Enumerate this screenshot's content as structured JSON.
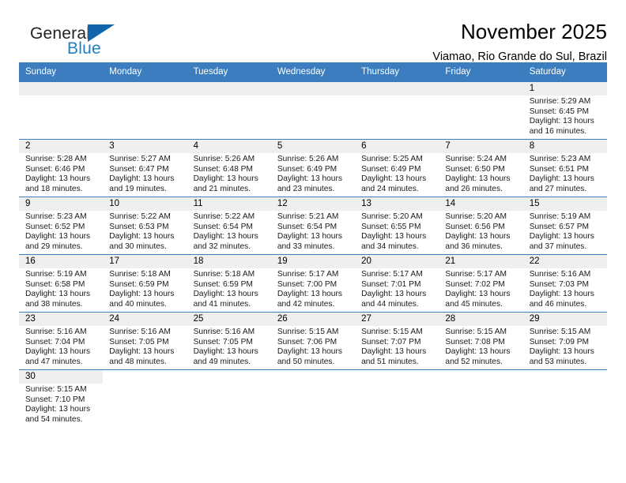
{
  "brand": {
    "name_part1": "General",
    "name_part2": "Blue",
    "triangle_color": "#1166ab",
    "blue_text_color": "#1f7fc4"
  },
  "header": {
    "month_title": "November 2025",
    "location": "Viamao, Rio Grande do Sul, Brazil"
  },
  "theme": {
    "header_row_bg": "#3b7dbf",
    "day_number_bg": "#efefef",
    "grid_line": "#3b7dbf"
  },
  "calendar": {
    "weekday_headers": [
      "Sunday",
      "Monday",
      "Tuesday",
      "Wednesday",
      "Thursday",
      "Friday",
      "Saturday"
    ],
    "weeks": [
      [
        {
          "empty": true
        },
        {
          "empty": true
        },
        {
          "empty": true
        },
        {
          "empty": true
        },
        {
          "empty": true
        },
        {
          "empty": true
        },
        {
          "day": "1",
          "sunrise": "Sunrise: 5:29 AM",
          "sunset": "Sunset: 6:45 PM",
          "daylight1": "Daylight: 13 hours",
          "daylight2": "and 16 minutes."
        }
      ],
      [
        {
          "day": "2",
          "sunrise": "Sunrise: 5:28 AM",
          "sunset": "Sunset: 6:46 PM",
          "daylight1": "Daylight: 13 hours",
          "daylight2": "and 18 minutes."
        },
        {
          "day": "3",
          "sunrise": "Sunrise: 5:27 AM",
          "sunset": "Sunset: 6:47 PM",
          "daylight1": "Daylight: 13 hours",
          "daylight2": "and 19 minutes."
        },
        {
          "day": "4",
          "sunrise": "Sunrise: 5:26 AM",
          "sunset": "Sunset: 6:48 PM",
          "daylight1": "Daylight: 13 hours",
          "daylight2": "and 21 minutes."
        },
        {
          "day": "5",
          "sunrise": "Sunrise: 5:26 AM",
          "sunset": "Sunset: 6:49 PM",
          "daylight1": "Daylight: 13 hours",
          "daylight2": "and 23 minutes."
        },
        {
          "day": "6",
          "sunrise": "Sunrise: 5:25 AM",
          "sunset": "Sunset: 6:49 PM",
          "daylight1": "Daylight: 13 hours",
          "daylight2": "and 24 minutes."
        },
        {
          "day": "7",
          "sunrise": "Sunrise: 5:24 AM",
          "sunset": "Sunset: 6:50 PM",
          "daylight1": "Daylight: 13 hours",
          "daylight2": "and 26 minutes."
        },
        {
          "day": "8",
          "sunrise": "Sunrise: 5:23 AM",
          "sunset": "Sunset: 6:51 PM",
          "daylight1": "Daylight: 13 hours",
          "daylight2": "and 27 minutes."
        }
      ],
      [
        {
          "day": "9",
          "sunrise": "Sunrise: 5:23 AM",
          "sunset": "Sunset: 6:52 PM",
          "daylight1": "Daylight: 13 hours",
          "daylight2": "and 29 minutes."
        },
        {
          "day": "10",
          "sunrise": "Sunrise: 5:22 AM",
          "sunset": "Sunset: 6:53 PM",
          "daylight1": "Daylight: 13 hours",
          "daylight2": "and 30 minutes."
        },
        {
          "day": "11",
          "sunrise": "Sunrise: 5:22 AM",
          "sunset": "Sunset: 6:54 PM",
          "daylight1": "Daylight: 13 hours",
          "daylight2": "and 32 minutes."
        },
        {
          "day": "12",
          "sunrise": "Sunrise: 5:21 AM",
          "sunset": "Sunset: 6:54 PM",
          "daylight1": "Daylight: 13 hours",
          "daylight2": "and 33 minutes."
        },
        {
          "day": "13",
          "sunrise": "Sunrise: 5:20 AM",
          "sunset": "Sunset: 6:55 PM",
          "daylight1": "Daylight: 13 hours",
          "daylight2": "and 34 minutes."
        },
        {
          "day": "14",
          "sunrise": "Sunrise: 5:20 AM",
          "sunset": "Sunset: 6:56 PM",
          "daylight1": "Daylight: 13 hours",
          "daylight2": "and 36 minutes."
        },
        {
          "day": "15",
          "sunrise": "Sunrise: 5:19 AM",
          "sunset": "Sunset: 6:57 PM",
          "daylight1": "Daylight: 13 hours",
          "daylight2": "and 37 minutes."
        }
      ],
      [
        {
          "day": "16",
          "sunrise": "Sunrise: 5:19 AM",
          "sunset": "Sunset: 6:58 PM",
          "daylight1": "Daylight: 13 hours",
          "daylight2": "and 38 minutes."
        },
        {
          "day": "17",
          "sunrise": "Sunrise: 5:18 AM",
          "sunset": "Sunset: 6:59 PM",
          "daylight1": "Daylight: 13 hours",
          "daylight2": "and 40 minutes."
        },
        {
          "day": "18",
          "sunrise": "Sunrise: 5:18 AM",
          "sunset": "Sunset: 6:59 PM",
          "daylight1": "Daylight: 13 hours",
          "daylight2": "and 41 minutes."
        },
        {
          "day": "19",
          "sunrise": "Sunrise: 5:17 AM",
          "sunset": "Sunset: 7:00 PM",
          "daylight1": "Daylight: 13 hours",
          "daylight2": "and 42 minutes."
        },
        {
          "day": "20",
          "sunrise": "Sunrise: 5:17 AM",
          "sunset": "Sunset: 7:01 PM",
          "daylight1": "Daylight: 13 hours",
          "daylight2": "and 44 minutes."
        },
        {
          "day": "21",
          "sunrise": "Sunrise: 5:17 AM",
          "sunset": "Sunset: 7:02 PM",
          "daylight1": "Daylight: 13 hours",
          "daylight2": "and 45 minutes."
        },
        {
          "day": "22",
          "sunrise": "Sunrise: 5:16 AM",
          "sunset": "Sunset: 7:03 PM",
          "daylight1": "Daylight: 13 hours",
          "daylight2": "and 46 minutes."
        }
      ],
      [
        {
          "day": "23",
          "sunrise": "Sunrise: 5:16 AM",
          "sunset": "Sunset: 7:04 PM",
          "daylight1": "Daylight: 13 hours",
          "daylight2": "and 47 minutes."
        },
        {
          "day": "24",
          "sunrise": "Sunrise: 5:16 AM",
          "sunset": "Sunset: 7:05 PM",
          "daylight1": "Daylight: 13 hours",
          "daylight2": "and 48 minutes."
        },
        {
          "day": "25",
          "sunrise": "Sunrise: 5:16 AM",
          "sunset": "Sunset: 7:05 PM",
          "daylight1": "Daylight: 13 hours",
          "daylight2": "and 49 minutes."
        },
        {
          "day": "26",
          "sunrise": "Sunrise: 5:15 AM",
          "sunset": "Sunset: 7:06 PM",
          "daylight1": "Daylight: 13 hours",
          "daylight2": "and 50 minutes."
        },
        {
          "day": "27",
          "sunrise": "Sunrise: 5:15 AM",
          "sunset": "Sunset: 7:07 PM",
          "daylight1": "Daylight: 13 hours",
          "daylight2": "and 51 minutes."
        },
        {
          "day": "28",
          "sunrise": "Sunrise: 5:15 AM",
          "sunset": "Sunset: 7:08 PM",
          "daylight1": "Daylight: 13 hours",
          "daylight2": "and 52 minutes."
        },
        {
          "day": "29",
          "sunrise": "Sunrise: 5:15 AM",
          "sunset": "Sunset: 7:09 PM",
          "daylight1": "Daylight: 13 hours",
          "daylight2": "and 53 minutes."
        }
      ],
      [
        {
          "day": "30",
          "sunrise": "Sunrise: 5:15 AM",
          "sunset": "Sunset: 7:10 PM",
          "daylight1": "Daylight: 13 hours",
          "daylight2": "and 54 minutes."
        },
        {
          "blank": true
        },
        {
          "blank": true
        },
        {
          "blank": true
        },
        {
          "blank": true
        },
        {
          "blank": true
        },
        {
          "blank": true
        }
      ]
    ]
  }
}
